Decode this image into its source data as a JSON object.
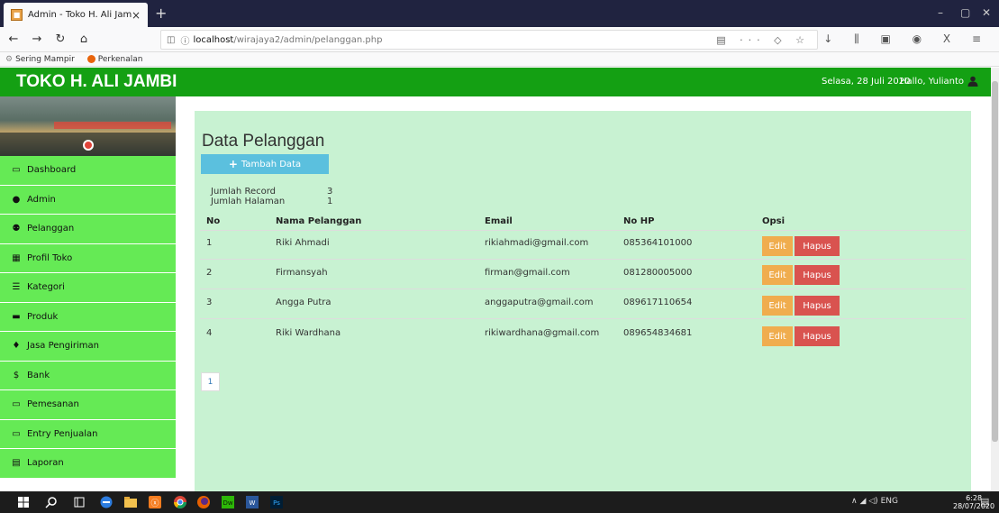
{
  "browser": {
    "tab_title": "Admin - Toko H. Ali Jambi",
    "url_host": "localhost",
    "url_path": "/wirajaya2/admin/pelanggan.php",
    "bookmarks": [
      "Sering Mampir",
      "Perkenalan"
    ]
  },
  "header": {
    "brand": "TOKO H. ALI JAMBI",
    "date": "Selasa, 28 Juli 2020",
    "greeting": "Hallo, Yulianto"
  },
  "sidebar": {
    "items": [
      {
        "label": "Dashboard",
        "icon": "monitor-icon"
      },
      {
        "label": "Admin",
        "icon": "user-icon"
      },
      {
        "label": "Pelanggan",
        "icon": "users-icon"
      },
      {
        "label": "Profil Toko",
        "icon": "table-icon"
      },
      {
        "label": "Kategori",
        "icon": "list-icon"
      },
      {
        "label": "Produk",
        "icon": "car-icon"
      },
      {
        "label": "Jasa Pengiriman",
        "icon": "map-marker-icon"
      },
      {
        "label": "Bank",
        "icon": "dollar-icon"
      },
      {
        "label": "Pemesanan",
        "icon": "credit-card-icon"
      },
      {
        "label": "Entry Penjualan",
        "icon": "credit-card-icon"
      },
      {
        "label": "Laporan",
        "icon": "report-icon"
      }
    ]
  },
  "main": {
    "title": "Data Pelanggan",
    "add_button": "Tambah Data",
    "record_label": "Jumlah Record",
    "record_value": "3",
    "page_label": "Jumlah Halaman",
    "page_value": "1",
    "columns": [
      "No",
      "Nama Pelanggan",
      "Email",
      "No HP",
      "Opsi"
    ],
    "rows": [
      {
        "no": "1",
        "nama": "Riki Ahmadi",
        "email": "rikiahmadi@gmail.com",
        "hp": "085364101000"
      },
      {
        "no": "2",
        "nama": "Firmansyah",
        "email": "firman@gmail.com",
        "hp": "081280005000"
      },
      {
        "no": "3",
        "nama": "Angga Putra",
        "email": "anggaputra@gmail.com",
        "hp": "089617110654"
      },
      {
        "no": "4",
        "nama": "Riki Wardhana",
        "email": "rikiwardhana@gmail.com",
        "hp": "089654834681"
      }
    ],
    "edit_label": "Edit",
    "delete_label": "Hapus",
    "pagination": [
      "1"
    ]
  },
  "taskbar": {
    "lang": "ENG",
    "time": "6:28",
    "date": "28/07/2020"
  },
  "colors": {
    "header_green": "#14a013",
    "sidebar_green": "#65ea55",
    "panel_green": "#c8f2d2",
    "add_button": "#5bc0de",
    "edit_button": "#f0ad4e",
    "delete_button": "#d9534f"
  }
}
